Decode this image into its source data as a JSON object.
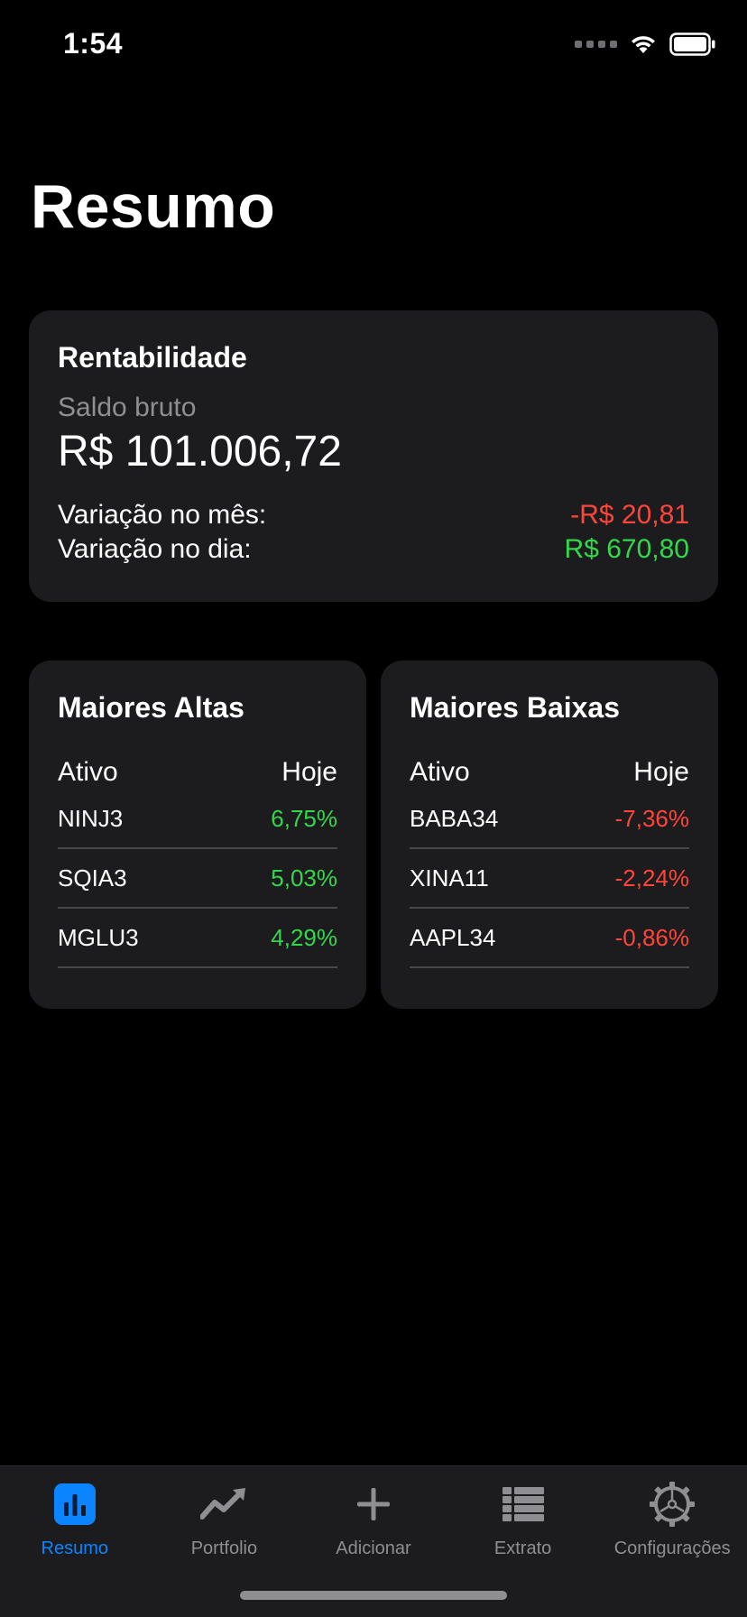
{
  "status_bar": {
    "time": "1:54"
  },
  "page": {
    "title": "Resumo"
  },
  "summary": {
    "title": "Rentabilidade",
    "balance_label": "Saldo bruto",
    "balance_value": "R$ 101.006,72",
    "month_label": "Variação no mês:",
    "month_value": "-R$ 20,81",
    "day_label": "Variação no dia:",
    "day_value": "R$ 670,80"
  },
  "gainers": {
    "title": "Maiores Altas",
    "col_asset": "Ativo",
    "col_today": "Hoje",
    "rows": [
      {
        "ticker": "NINJ3",
        "change": "6,75%"
      },
      {
        "ticker": "SQIA3",
        "change": "5,03%"
      },
      {
        "ticker": "MGLU3",
        "change": "4,29%"
      }
    ]
  },
  "losers": {
    "title": "Maiores Baixas",
    "col_asset": "Ativo",
    "col_today": "Hoje",
    "rows": [
      {
        "ticker": "BABA34",
        "change": "-7,36%"
      },
      {
        "ticker": "XINA11",
        "change": "-2,24%"
      },
      {
        "ticker": "AAPL34",
        "change": "-0,86%"
      }
    ]
  },
  "tabs": [
    {
      "label": "Resumo",
      "icon": "bar-chart-icon",
      "active": true
    },
    {
      "label": "Portfolio",
      "icon": "trend-up-icon",
      "active": false
    },
    {
      "label": "Adicionar",
      "icon": "plus-icon",
      "active": false
    },
    {
      "label": "Extrato",
      "icon": "list-icon",
      "active": false
    },
    {
      "label": "Configurações",
      "icon": "gear-icon",
      "active": false
    }
  ],
  "colors": {
    "background": "#000000",
    "card": "#1c1c1e",
    "accent": "#0a84ff",
    "positive": "#32d74b",
    "negative": "#ff453a",
    "muted": "#8e8e93"
  }
}
